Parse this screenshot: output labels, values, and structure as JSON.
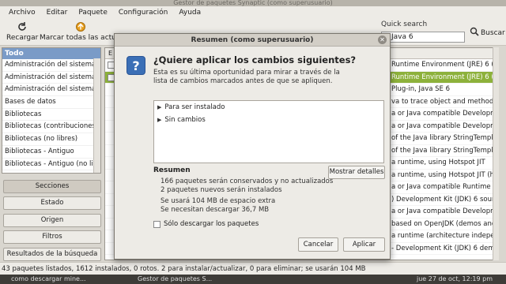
{
  "window": {
    "title": "Gestor de paquetes Synaptic (como superusuario)"
  },
  "menubar": [
    "Archivo",
    "Editar",
    "Paquete",
    "Configuración",
    "Ayuda"
  ],
  "toolbar": {
    "reload_label": "Recargar",
    "mark_all_label": "Marcar todas las actual",
    "quick_search_label": "Quick search",
    "quick_search_value": "Java 6",
    "search_button_label": "Buscar"
  },
  "sidebar": {
    "header": "Todo",
    "items": [
      "Administración del sistema",
      "Administración del sistema (",
      "Administración del sistema (",
      "Bases de datos",
      "Bibliotecas",
      "Bibliotecas (contribuciones)",
      "Bibliotecas (no libres)",
      "Bibliotecas - Antiguo",
      "Bibliotecas - Antiguo (no libre"
    ],
    "buttons": [
      "Secciones",
      "Estado",
      "Origen",
      "Filtros",
      "Resultados de la búsqueda"
    ]
  },
  "package_list": {
    "header": "E",
    "rows": [
      "Runtime Environment (JRE) 6 (",
      "Runtime Environment (JRE) 6 (a",
      "Plug-in, Java SE 6",
      "va to trace object and method ti",
      "a or Java compatible Developme",
      "a or Java compatible Developme",
      "of the Java library StringTemplate",
      "of the Java library StringTemplate",
      "a runtime, using Hotspot JIT",
      "a runtime, using Hotspot JIT (hea",
      "a or Java compatible Runtime (he",
      ") Development Kit (JDK) 6 source",
      "a or Java compatible Developme",
      "based on OpenJDK (demos and",
      "a runtime (architecture independ",
      "- Development Kit (JDK) 6 demo"
    ]
  },
  "status_bar": "43 paquetes listados, 1612 instalados, 0 rotos. 2 para instalar/actualizar, 0 para eliminar; se usarán 104 MB",
  "taskbar": {
    "item1": "como descargar mine...",
    "item2": "Gestor de paquetes S...",
    "clock": "jue 27 de oct, 12:19 pm"
  },
  "dialog": {
    "title": "Resumen (como superusuario)",
    "heading": "¿Quiere aplicar los cambios siguientes?",
    "description": "Esta es su última oportunidad para mirar a través de la lista de cambios marcados antes de que se apliquen.",
    "tree": [
      "Para ser instalado",
      "Sin cambios"
    ],
    "summary_title": "Resumen",
    "summary_lines": [
      "166 paquetes serán conservados y no actualizados",
      "2 paquetes nuevos serán instalados",
      "Se usará 104 MB de espacio extra",
      "Se necesitan descargar 36,7 MB"
    ],
    "details_button": "Mostrar detalles",
    "download_only_label": "Sólo descargar los paquetes",
    "cancel_button": "Cancelar",
    "apply_button": "Aplicar"
  },
  "colors": {
    "selection": "#8db13b",
    "sidebar_header": "#7a9bc7",
    "dialog_icon": "#3b6fb6"
  }
}
